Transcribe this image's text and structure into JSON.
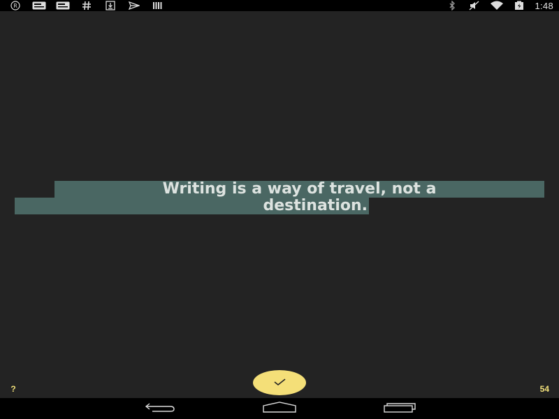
{
  "status_bar": {
    "time": "1:48",
    "left_icons": [
      "registered-icon",
      "notification-card-icon",
      "notification-card-icon",
      "hashtag-icon",
      "download-icon",
      "send-icon",
      "barcode-icon"
    ],
    "right_icons": [
      "bluetooth-icon",
      "muted-icon",
      "wifi-icon",
      "battery-charging-icon"
    ]
  },
  "quote": {
    "line1": "Writing is a way of travel, not a",
    "line2": "destination.",
    "highlight_color": "#4a6763",
    "text_color": "#dde3e0"
  },
  "controls": {
    "help_label": "?",
    "done_icon": "checkmark-icon",
    "word_count": "54",
    "accent_color": "#f4df78"
  },
  "nav_bar": {
    "buttons": [
      "back-icon",
      "home-icon",
      "recents-icon"
    ]
  }
}
